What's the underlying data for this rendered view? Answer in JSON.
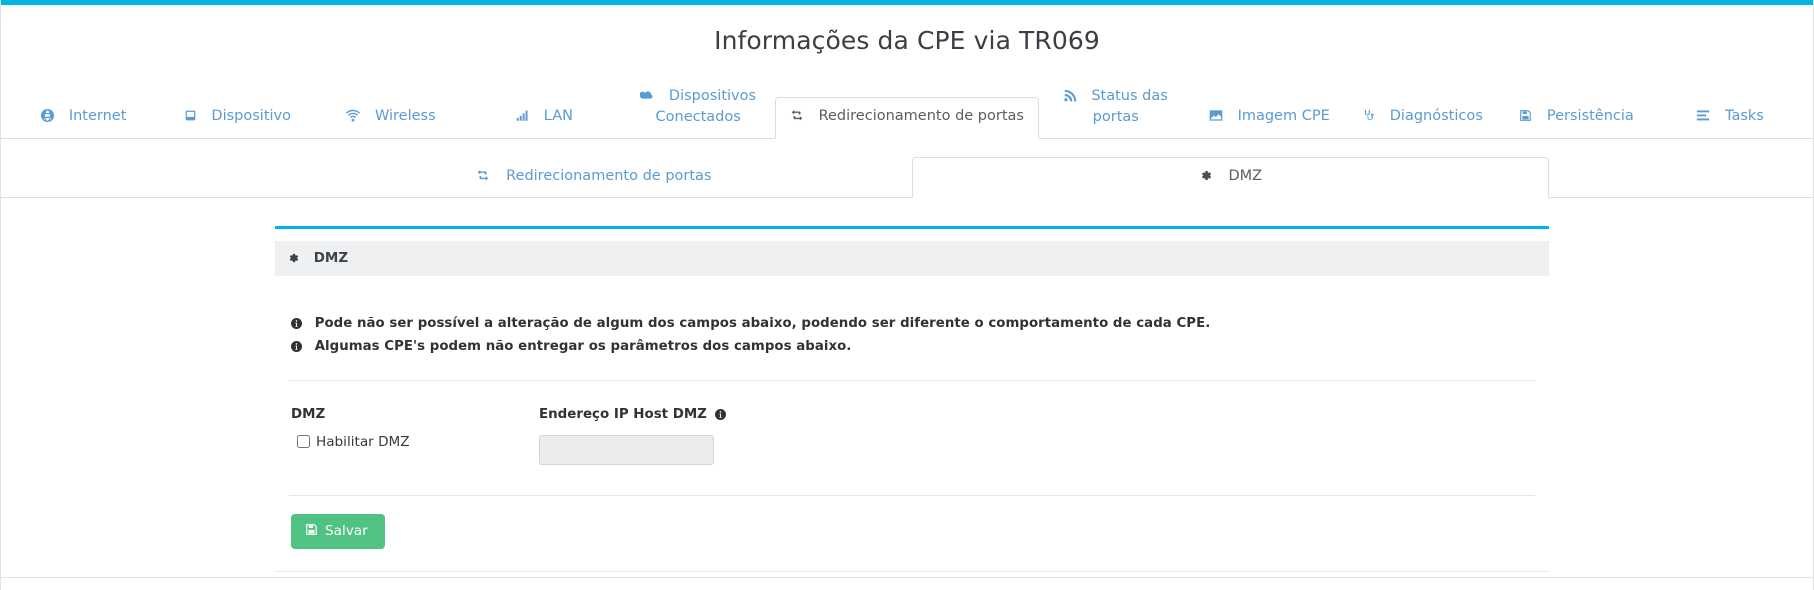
{
  "header": {
    "title": "Informações da CPE via TR069",
    "accent_color": "#00b5e2"
  },
  "main_tabs": [
    {
      "label": "Internet",
      "icon": "globe-icon",
      "active": false
    },
    {
      "label": "Dispositivo",
      "icon": "device-icon",
      "active": false
    },
    {
      "label": "Wireless",
      "icon": "wifi-icon",
      "active": false
    },
    {
      "label": "LAN",
      "icon": "signal-bars-icon",
      "active": false
    },
    {
      "label": "Dispositivos Conectados",
      "icon": "cloud-icon",
      "active": false
    },
    {
      "label": "Redirecionamento de portas",
      "icon": "exchange-icon",
      "active": true
    },
    {
      "label": "Status das portas",
      "icon": "rss-icon",
      "active": false
    },
    {
      "label": "Imagem CPE",
      "icon": "image-icon",
      "active": false
    },
    {
      "label": "Diagnósticos",
      "icon": "stethoscope-icon",
      "active": false
    },
    {
      "label": "Persistência",
      "icon": "floppy-disk-icon",
      "active": false
    },
    {
      "label": "Tasks",
      "icon": "list-icon",
      "active": false
    }
  ],
  "sub_tabs": [
    {
      "label": "Redirecionamento de portas",
      "icon": "exchange-icon",
      "active": false
    },
    {
      "label": "DMZ",
      "icon": "gear-icon",
      "active": true
    }
  ],
  "panel": {
    "heading": "DMZ",
    "heading_icon": "gear-icon",
    "notes": [
      "Pode não ser possível a alteração de algum dos campos abaixo, podendo ser diferente o comportamento de cada CPE.",
      "Algumas CPE's podem não entregar os parâmetros dos campos abaixo."
    ],
    "fields": {
      "dmz": {
        "label": "DMZ",
        "checkbox_label": "Habilitar DMZ",
        "checked": false
      },
      "dmz_host_ip": {
        "label": "Endereço IP Host DMZ",
        "info_icon": "info-circle-icon",
        "value": "",
        "placeholder": ""
      }
    },
    "save_button": {
      "label": "Salvar",
      "icon": "floppy-disk-icon",
      "color": "#4fc284"
    }
  }
}
